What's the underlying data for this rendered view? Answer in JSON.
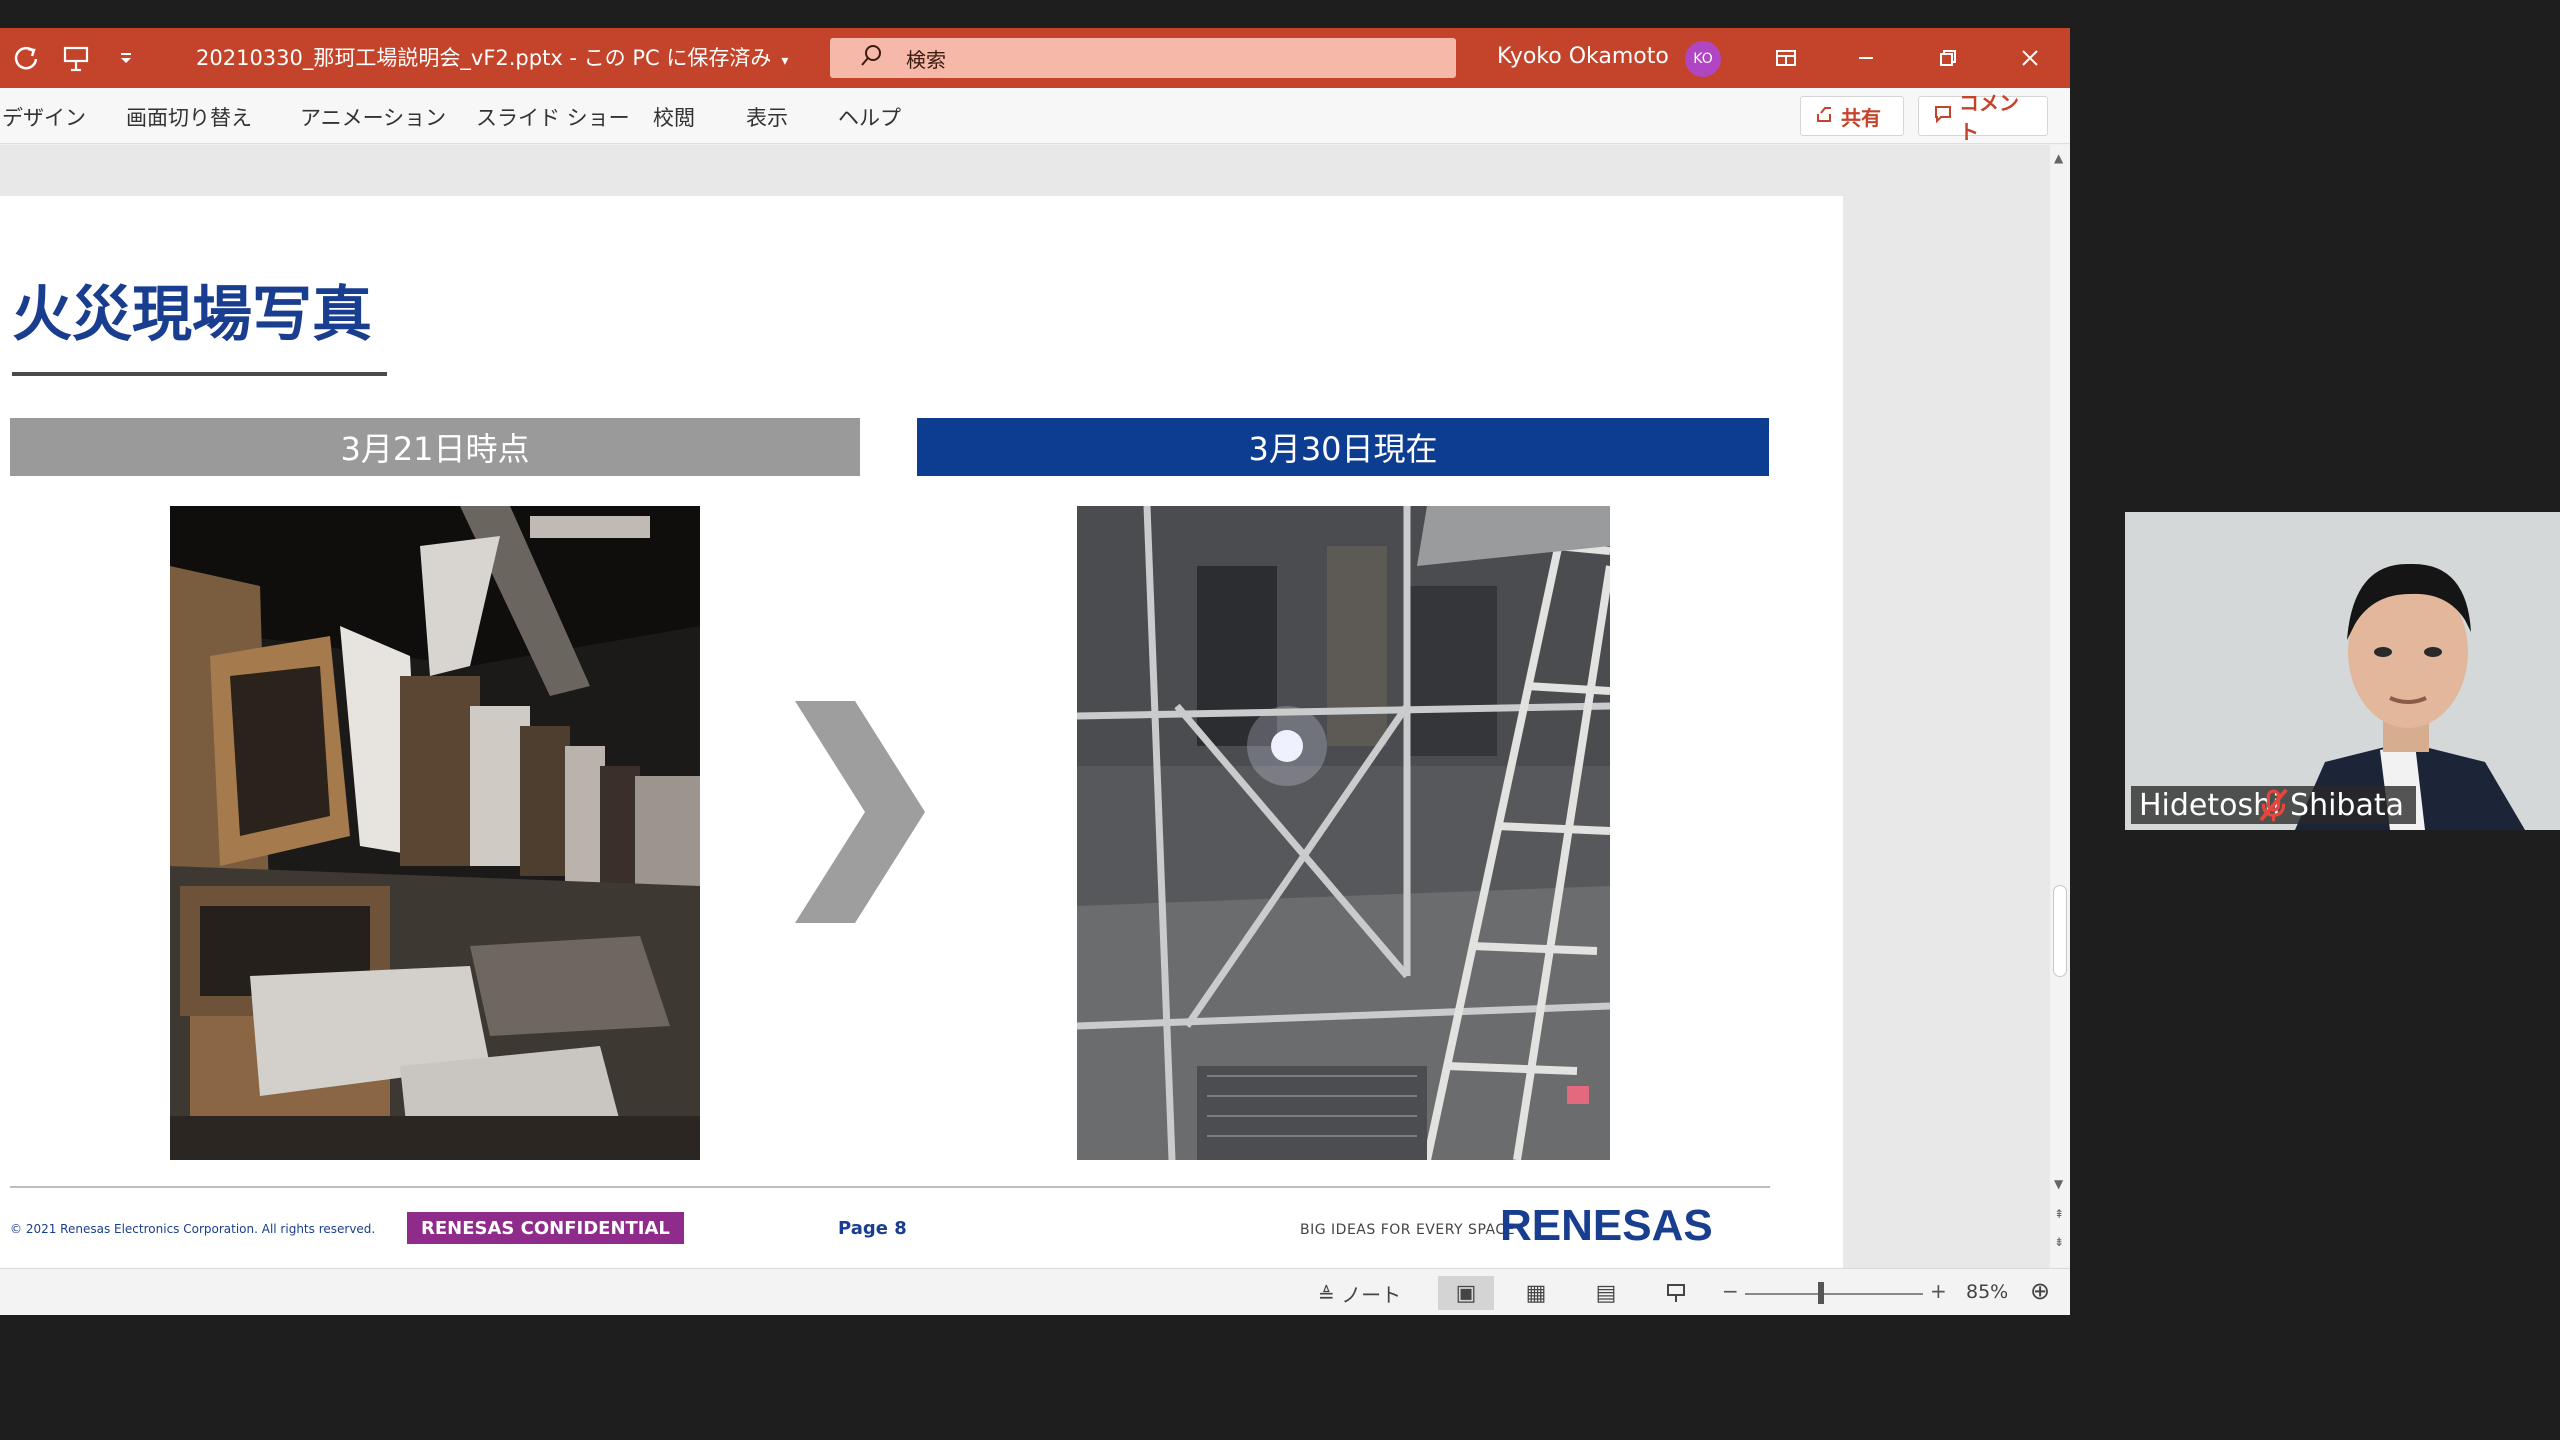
{
  "window": {
    "doc_title": "20210330_那珂工場説明会_vF2.pptx - この PC に保存済み",
    "search_placeholder": "検索",
    "user_name": "Kyoko Okamoto",
    "user_initials": "KO"
  },
  "ribbon": {
    "tabs": [
      "デザイン",
      "画面切り替え",
      "アニメーション",
      "スライド ショー",
      "校閲",
      "表示",
      "ヘルプ"
    ],
    "share_label": "共有",
    "comment_label": "コメント"
  },
  "slide": {
    "title": "火災現場写真",
    "left_label": "3月21日時点",
    "right_label": "3月30日現在",
    "copyright": "© 2021 Renesas Electronics Corporation. All rights reserved.",
    "confidential": "RENESAS CONFIDENTIAL",
    "page": "Page 8",
    "tagline": "BIG IDEAS FOR EVERY SPACE",
    "brand": "RENESAS",
    "colors": {
      "title": "#1a3e8f",
      "left_bar": "#9a9a9a",
      "right_bar": "#0d3d91",
      "confidential": "#8f2b8b"
    }
  },
  "statusbar": {
    "notes_label": "ノート",
    "zoom": "85%"
  },
  "participant": {
    "name": "Hidetoshi Shibata"
  },
  "icons": [
    "refresh-icon",
    "present-icon",
    "customize-icon",
    "search-icon",
    "ribbon-display-icon",
    "minimize-icon",
    "restore-icon",
    "close-icon",
    "share-icon",
    "comment-icon",
    "notes-icon",
    "normal-view-icon",
    "slide-sorter-icon",
    "reading-view-icon",
    "slideshow-icon",
    "fit-slide-icon",
    "mic-off-icon"
  ]
}
